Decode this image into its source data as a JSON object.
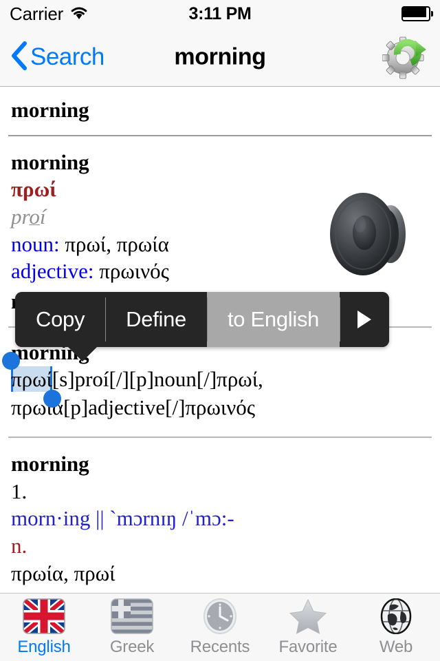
{
  "status_bar": {
    "carrier": "Carrier",
    "wifi_icon": "wifi-icon",
    "time": "3:11 PM",
    "battery_icon": "battery-full-icon"
  },
  "nav_bar": {
    "back_label": "Search",
    "back_icon": "chevron-left-icon",
    "title": "morning",
    "action_icon": "gear-refresh-icon"
  },
  "entry": {
    "headword_top": "morning",
    "speaker_icon": "speaker-icon",
    "translation": {
      "headword": "morning",
      "greek": "πρωί",
      "transliteration_pre": "pr",
      "transliteration_underline": "o",
      "transliteration_post": "í",
      "noun_label": "noun:",
      "noun_value": " πρωί, πρωία",
      "adjective_label": "adjective:",
      "adjective_value": " πρωινός"
    },
    "raw": {
      "headword": "morning",
      "selected_text": "πρωί",
      "line1_rest": "[s]proí[/][p]noun[/]πρωί,",
      "line2": "πρωία[p]adjective[/]πρωινός"
    },
    "definition": {
      "headword": "morning",
      "sense_number": "1.",
      "phonetic": "morn·ing || `mɔrnɪŋ /ˈmɔ:-",
      "part_of_speech": "n.",
      "gloss": "πρωία, πρωί"
    }
  },
  "context_menu": {
    "items": [
      {
        "label": "Copy",
        "active": false
      },
      {
        "label": "Define",
        "active": false
      },
      {
        "label": "to English",
        "active": true
      }
    ],
    "more_icon": "play-triangle-icon"
  },
  "tab_bar": {
    "tabs": [
      {
        "label": "English",
        "icon": "uk-flag-icon",
        "active": true
      },
      {
        "label": "Greek",
        "icon": "greek-flag-icon",
        "active": false
      },
      {
        "label": "Recents",
        "icon": "clock-icon",
        "active": false
      },
      {
        "label": "Favorite",
        "icon": "star-icon",
        "active": false
      },
      {
        "label": "Web",
        "icon": "globe-icon",
        "active": false
      }
    ]
  },
  "colors": {
    "accent_blue": "#007aff",
    "greek_red": "#9c2020",
    "link_blue": "#0000ee",
    "selection_fill": "#c9dcf0",
    "selection_handle": "#1a74dc",
    "menu_bg": "#262626",
    "menu_active_bg": "#a8a8a8"
  }
}
